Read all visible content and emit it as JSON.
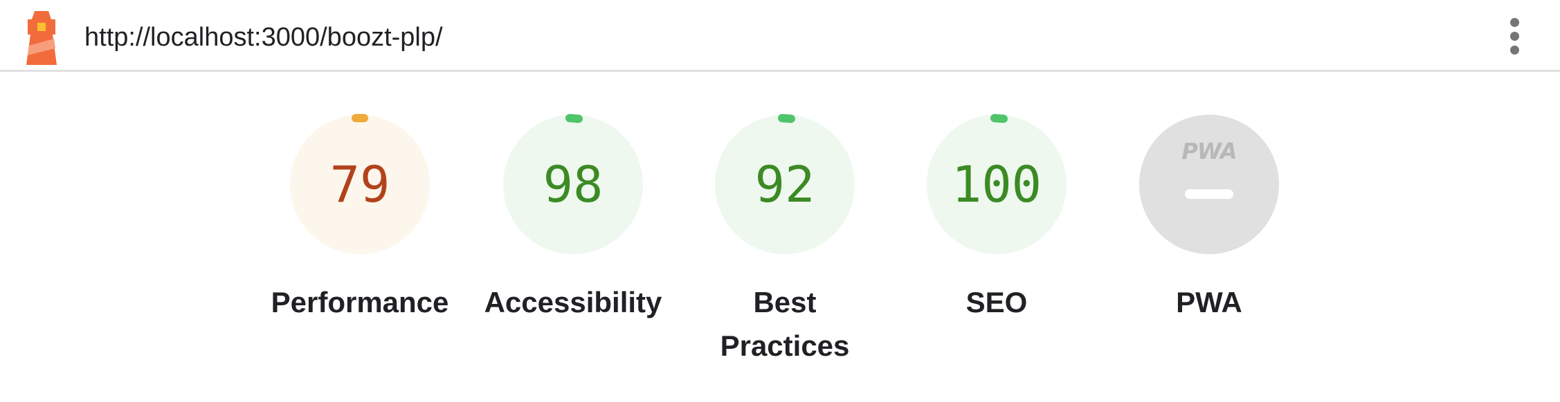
{
  "header": {
    "url": "http://localhost:3000/boozt-plp/",
    "logo_icon": "lighthouse-icon",
    "menu_icon": "more-vert-icon"
  },
  "categories": [
    {
      "id": "performance",
      "score": "79",
      "score_fraction": 0.79,
      "label": "Performance",
      "status": "average",
      "color": "#b2421b",
      "fill": "#fdf6ec",
      "arc": "#f0a93b"
    },
    {
      "id": "accessibility",
      "score": "98",
      "score_fraction": 0.98,
      "label": "Accessibility",
      "status": "pass",
      "color": "#3c8a24",
      "fill": "#eef8ef",
      "arc": "#4fc46b"
    },
    {
      "id": "best-practices",
      "score": "92",
      "score_fraction": 0.92,
      "label": "Best Practices",
      "status": "pass",
      "color": "#3c8a24",
      "fill": "#eef8ef",
      "arc": "#4fc46b"
    },
    {
      "id": "seo",
      "score": "100",
      "score_fraction": 1.0,
      "label": "SEO",
      "status": "pass",
      "color": "#3c8a24",
      "fill": "#eef8ef",
      "arc": "#4fc46b"
    },
    {
      "id": "pwa",
      "badge": "PWA",
      "label": "PWA",
      "status": "not-applicable",
      "fill": "#e0e0e0"
    }
  ]
}
